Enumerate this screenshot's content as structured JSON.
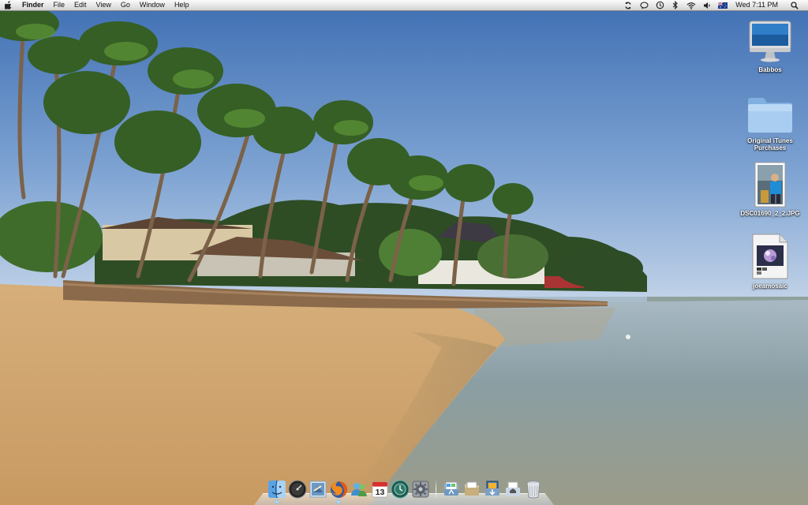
{
  "menubar": {
    "apple_menu": "apple-icon",
    "app_name": "Finder",
    "menus": [
      "File",
      "Edit",
      "View",
      "Go",
      "Window",
      "Help"
    ],
    "status_icons": [
      "sync-icon",
      "chat-icon",
      "time-machine-icon",
      "bluetooth-icon",
      "wifi-icon",
      "volume-icon",
      "australia-flag-icon"
    ],
    "clock": "Wed 7:11 PM",
    "spotlight": "spotlight-search-icon"
  },
  "desktop_icons": [
    {
      "label": "Babbos",
      "icon": "imac-computer-icon"
    },
    {
      "label": "Original iTunes Purchases",
      "icon": "folder-icon"
    },
    {
      "label": "DSC01690_2_2.JPG",
      "icon": "photo-thumbnail-icon"
    },
    {
      "label": "joeamosaic",
      "icon": "image-document-icon"
    }
  ],
  "dock": {
    "apps": [
      {
        "name": "Finder",
        "icon": "finder-icon",
        "running": true
      },
      {
        "name": "Dashboard",
        "icon": "dashboard-icon",
        "running": false
      },
      {
        "name": "Mail",
        "icon": "mail-stamp-icon",
        "running": false
      },
      {
        "name": "Firefox",
        "icon": "firefox-icon",
        "running": true
      },
      {
        "name": "iChat",
        "icon": "contacts-people-icon",
        "running": false
      },
      {
        "name": "iCal",
        "icon": "calendar-icon",
        "running": false
      },
      {
        "name": "Time Machine",
        "icon": "time-machine-dock-icon",
        "running": false
      },
      {
        "name": "System Preferences",
        "icon": "system-preferences-icon",
        "running": false
      }
    ],
    "stacks": [
      {
        "name": "Applications",
        "icon": "applications-stack-icon"
      },
      {
        "name": "Documents",
        "icon": "documents-stack-icon"
      },
      {
        "name": "Downloads",
        "icon": "downloads-stack-icon"
      },
      {
        "name": "Home",
        "icon": "home-folder-icon"
      },
      {
        "name": "Trash",
        "icon": "trash-icon"
      }
    ],
    "calendar_day": "13"
  },
  "colors": {
    "sky_top": "#4f7fbf",
    "sky_bottom": "#b9cde6",
    "sand": "#d9b27a",
    "sea": "#8da3aa",
    "accent_running": "#4aa8ff"
  }
}
